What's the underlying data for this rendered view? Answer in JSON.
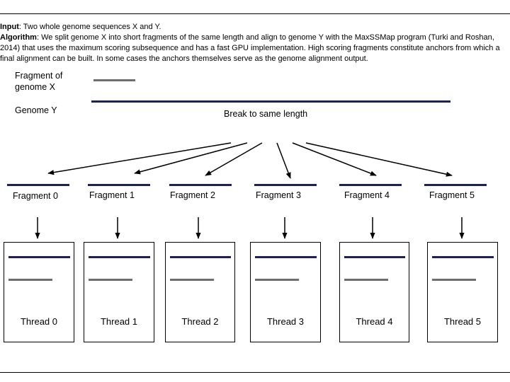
{
  "description": {
    "input_label": "Input",
    "input_text": ": Two whole genome sequences X and Y.",
    "algorithm_label": "Algorithm",
    "algorithm_text": ": We split genome X into short fragments of the same length and align to genome Y with the MaxSSMap program (Turki and Roshan, 2014) that uses the maximum scoring subsequence and has a fast GPU implementation. High scoring fragments constitute anchors from which a final alignment can be built. In some cases the anchors themselves serve as the genome alignment output."
  },
  "legend": {
    "fragment_label_line1": "Fragment of",
    "fragment_label_line2": "genome X",
    "genome_y_label": "Genome Y"
  },
  "break_label": "Break to same length",
  "fragments": [
    {
      "label": "Fragment 0",
      "thread": "Thread 0"
    },
    {
      "label": "Fragment 1",
      "thread": "Thread 1"
    },
    {
      "label": "Fragment 2",
      "thread": "Thread 2"
    },
    {
      "label": "Fragment 3",
      "thread": "Thread 3"
    },
    {
      "label": "Fragment 4",
      "thread": "Thread 4"
    },
    {
      "label": "Fragment 5",
      "thread": "Thread 5"
    }
  ],
  "colors": {
    "genome_y": "#1f2150",
    "fragment_x": "#6e6e6e"
  }
}
